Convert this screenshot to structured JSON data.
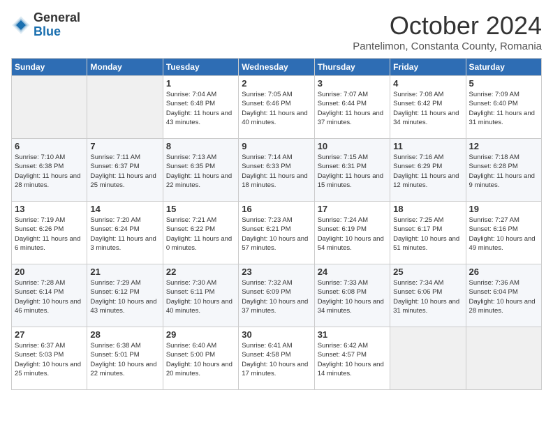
{
  "header": {
    "logo_general": "General",
    "logo_blue": "Blue",
    "month_title": "October 2024",
    "location": "Pantelimon, Constanta County, Romania"
  },
  "columns": [
    "Sunday",
    "Monday",
    "Tuesday",
    "Wednesday",
    "Thursday",
    "Friday",
    "Saturday"
  ],
  "weeks": [
    [
      {
        "day": "",
        "empty": true
      },
      {
        "day": "",
        "empty": true
      },
      {
        "day": "1",
        "sunrise": "7:04 AM",
        "sunset": "6:48 PM",
        "daylight": "11 hours and 43 minutes."
      },
      {
        "day": "2",
        "sunrise": "7:05 AM",
        "sunset": "6:46 PM",
        "daylight": "11 hours and 40 minutes."
      },
      {
        "day": "3",
        "sunrise": "7:07 AM",
        "sunset": "6:44 PM",
        "daylight": "11 hours and 37 minutes."
      },
      {
        "day": "4",
        "sunrise": "7:08 AM",
        "sunset": "6:42 PM",
        "daylight": "11 hours and 34 minutes."
      },
      {
        "day": "5",
        "sunrise": "7:09 AM",
        "sunset": "6:40 PM",
        "daylight": "11 hours and 31 minutes."
      }
    ],
    [
      {
        "day": "6",
        "sunrise": "7:10 AM",
        "sunset": "6:38 PM",
        "daylight": "11 hours and 28 minutes."
      },
      {
        "day": "7",
        "sunrise": "7:11 AM",
        "sunset": "6:37 PM",
        "daylight": "11 hours and 25 minutes."
      },
      {
        "day": "8",
        "sunrise": "7:13 AM",
        "sunset": "6:35 PM",
        "daylight": "11 hours and 22 minutes."
      },
      {
        "day": "9",
        "sunrise": "7:14 AM",
        "sunset": "6:33 PM",
        "daylight": "11 hours and 18 minutes."
      },
      {
        "day": "10",
        "sunrise": "7:15 AM",
        "sunset": "6:31 PM",
        "daylight": "11 hours and 15 minutes."
      },
      {
        "day": "11",
        "sunrise": "7:16 AM",
        "sunset": "6:29 PM",
        "daylight": "11 hours and 12 minutes."
      },
      {
        "day": "12",
        "sunrise": "7:18 AM",
        "sunset": "6:28 PM",
        "daylight": "11 hours and 9 minutes."
      }
    ],
    [
      {
        "day": "13",
        "sunrise": "7:19 AM",
        "sunset": "6:26 PM",
        "daylight": "11 hours and 6 minutes."
      },
      {
        "day": "14",
        "sunrise": "7:20 AM",
        "sunset": "6:24 PM",
        "daylight": "11 hours and 3 minutes."
      },
      {
        "day": "15",
        "sunrise": "7:21 AM",
        "sunset": "6:22 PM",
        "daylight": "11 hours and 0 minutes."
      },
      {
        "day": "16",
        "sunrise": "7:23 AM",
        "sunset": "6:21 PM",
        "daylight": "10 hours and 57 minutes."
      },
      {
        "day": "17",
        "sunrise": "7:24 AM",
        "sunset": "6:19 PM",
        "daylight": "10 hours and 54 minutes."
      },
      {
        "day": "18",
        "sunrise": "7:25 AM",
        "sunset": "6:17 PM",
        "daylight": "10 hours and 51 minutes."
      },
      {
        "day": "19",
        "sunrise": "7:27 AM",
        "sunset": "6:16 PM",
        "daylight": "10 hours and 49 minutes."
      }
    ],
    [
      {
        "day": "20",
        "sunrise": "7:28 AM",
        "sunset": "6:14 PM",
        "daylight": "10 hours and 46 minutes."
      },
      {
        "day": "21",
        "sunrise": "7:29 AM",
        "sunset": "6:12 PM",
        "daylight": "10 hours and 43 minutes."
      },
      {
        "day": "22",
        "sunrise": "7:30 AM",
        "sunset": "6:11 PM",
        "daylight": "10 hours and 40 minutes."
      },
      {
        "day": "23",
        "sunrise": "7:32 AM",
        "sunset": "6:09 PM",
        "daylight": "10 hours and 37 minutes."
      },
      {
        "day": "24",
        "sunrise": "7:33 AM",
        "sunset": "6:08 PM",
        "daylight": "10 hours and 34 minutes."
      },
      {
        "day": "25",
        "sunrise": "7:34 AM",
        "sunset": "6:06 PM",
        "daylight": "10 hours and 31 minutes."
      },
      {
        "day": "26",
        "sunrise": "7:36 AM",
        "sunset": "6:04 PM",
        "daylight": "10 hours and 28 minutes."
      }
    ],
    [
      {
        "day": "27",
        "sunrise": "6:37 AM",
        "sunset": "5:03 PM",
        "daylight": "10 hours and 25 minutes."
      },
      {
        "day": "28",
        "sunrise": "6:38 AM",
        "sunset": "5:01 PM",
        "daylight": "10 hours and 22 minutes."
      },
      {
        "day": "29",
        "sunrise": "6:40 AM",
        "sunset": "5:00 PM",
        "daylight": "10 hours and 20 minutes."
      },
      {
        "day": "30",
        "sunrise": "6:41 AM",
        "sunset": "4:58 PM",
        "daylight": "10 hours and 17 minutes."
      },
      {
        "day": "31",
        "sunrise": "6:42 AM",
        "sunset": "4:57 PM",
        "daylight": "10 hours and 14 minutes."
      },
      {
        "day": "",
        "empty": true
      },
      {
        "day": "",
        "empty": true
      }
    ]
  ]
}
